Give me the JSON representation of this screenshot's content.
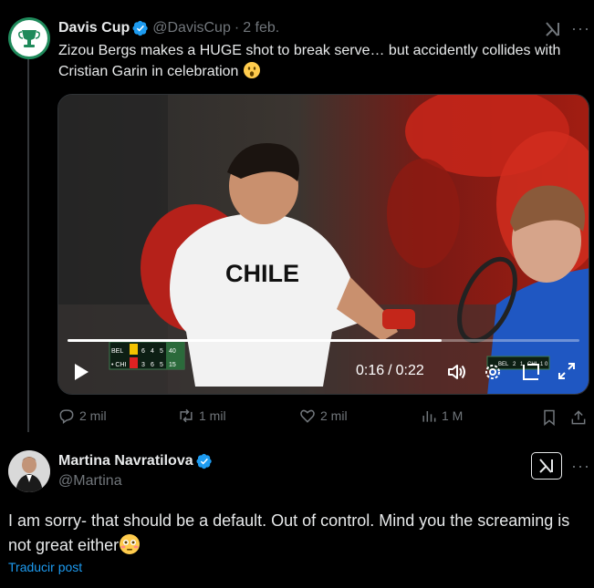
{
  "tweet1": {
    "display_name": "Davis Cup",
    "handle": "@DavisCup",
    "separator": "·",
    "date": "2 feb.",
    "text": "Zizou Bergs makes a HUGE shot to break serve… but accidently collides with Cristian Garin in celebration",
    "video": {
      "jersey_text": "CHILE",
      "current_time": "0:16",
      "time_separator": "/",
      "duration": "0:22",
      "progress": 0.73,
      "scoreboard": {
        "rows": [
          {
            "team": "BEL",
            "scores": [
              "6",
              "4",
              "5",
              "40"
            ]
          },
          {
            "team": "• CHI",
            "scores": [
              "3",
              "6",
              "5",
              "15"
            ]
          }
        ]
      },
      "mini_scoreboard": {
        "rows": [
          {
            "team": "BEL",
            "scores": [
              "2",
              "1"
            ]
          },
          {
            "team": "CHI",
            "scores": [
              "1",
              "0"
            ]
          }
        ]
      }
    },
    "actions": {
      "replies": "2 mil",
      "reposts": "1 mil",
      "likes": "2 mil",
      "views": "1 M"
    }
  },
  "tweet2": {
    "display_name": "Martina Navratilova",
    "handle": "@Martina",
    "text": "I am sorry- that should be a default. Out of control. Mind you the screaming is not great either",
    "translate_label": "Traducir post"
  },
  "colors": {
    "accent": "#1d9bf0",
    "muted": "#71767b",
    "text": "#e7e9ea",
    "background": "#000000",
    "verified": "#1d9bf0"
  },
  "icons": {
    "verified": "verified-badge-icon",
    "grok": "grok-icon",
    "more": "more-icon",
    "reply": "reply-icon",
    "repost": "repost-icon",
    "like": "heart-icon",
    "views": "views-icon",
    "bookmark": "bookmark-icon",
    "share": "share-icon"
  }
}
